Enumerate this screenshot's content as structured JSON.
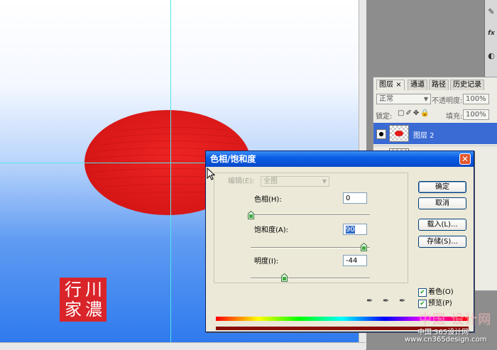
{
  "canvas": {
    "seal_chars": [
      "川",
      "行",
      "家",
      "濃"
    ]
  },
  "layers_panel": {
    "tabs": [
      "图层",
      "通道",
      "路径",
      "历史记录"
    ],
    "tab_close": "×",
    "blend_mode": "正常",
    "opacity_label": "不透明度:",
    "opacity_value": "100%",
    "lock_label": "锁定:",
    "fill_label": "填充:",
    "fill_value": "100%",
    "active_layer": "图层 2"
  },
  "dialog": {
    "title": "色相/饱和度",
    "close_glyph": "✕",
    "edit_label": "编辑(E):",
    "edit_value": "全图",
    "hue_label": "色相(H):",
    "hue_value": "0",
    "hue_level": 0.0,
    "saturation_label": "饱和度(A):",
    "saturation_value": "90",
    "saturation_level": 0.95,
    "lightness_label": "明度(I):",
    "lightness_value": "-44",
    "lightness_level": 0.28,
    "buttons": {
      "ok": "确定",
      "cancel": "取消",
      "load": "载入(L)...",
      "save": "存储(S)..."
    },
    "colorize_label": "着色(O)",
    "colorize_checked": true,
    "preview_label": "预览(P)",
    "preview_checked": true
  },
  "watermark": {
    "logo": "中国 设计网",
    "line1": "中国 365设计网",
    "line2": "www.cn365design.com"
  },
  "colors": {
    "petal_red": "#e41b1b",
    "seal_red": "#d9242a",
    "titlebar_blue": "#0a5ee6",
    "selected_layer": "#3a6ad4"
  }
}
